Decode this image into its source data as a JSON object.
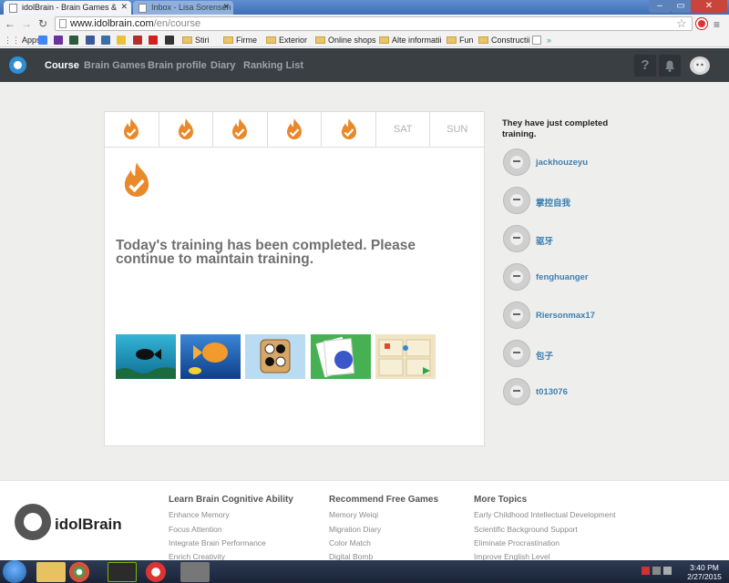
{
  "browser": {
    "tabs": [
      {
        "title": "idolBrain - Brain Games &"
      },
      {
        "title": "Inbox - Lisa Sorensen"
      }
    ],
    "url_host": "www.idolbrain.com",
    "url_path": "/en/course",
    "bookmarks": [
      {
        "label": "Apps",
        "icon": "apps-grid-icon"
      },
      {
        "label": "Stiri",
        "icon": "folder-icon"
      },
      {
        "label": "Firme",
        "icon": "folder-icon"
      },
      {
        "label": "Exterior",
        "icon": "folder-icon"
      },
      {
        "label": "Online shops",
        "icon": "folder-icon"
      },
      {
        "label": "Alte informatii",
        "icon": "folder-icon"
      },
      {
        "label": "Fun",
        "icon": "folder-icon"
      },
      {
        "label": "Constructii",
        "icon": "folder-icon"
      }
    ]
  },
  "site": {
    "nav": [
      {
        "label": "Course",
        "active": true
      },
      {
        "label": "Brain Games",
        "active": false
      },
      {
        "label": "Brain profile",
        "active": false
      },
      {
        "label": "Diary",
        "active": false
      },
      {
        "label": "Ranking List",
        "active": false
      }
    ],
    "help_label": "?"
  },
  "week": [
    {
      "label": "",
      "done": true
    },
    {
      "label": "",
      "done": true
    },
    {
      "label": "",
      "done": true
    },
    {
      "label": "",
      "done": true
    },
    {
      "label": "",
      "done": true
    },
    {
      "label": "SAT",
      "done": false
    },
    {
      "label": "SUN",
      "done": false
    }
  ],
  "completion_message": "Today's training has been completed. Please continue to maintain training.",
  "games": [
    {
      "icon": "fish-game-icon",
      "bg": "#1a8fb0"
    },
    {
      "icon": "goldfish-game-icon",
      "bg": "#1e6cc4"
    },
    {
      "icon": "go-stones-game-icon",
      "bg": "#a8d4ee"
    },
    {
      "icon": "cards-game-icon",
      "bg": "#3fae4f"
    },
    {
      "icon": "puzzle-game-icon",
      "bg": "#efe0be"
    }
  ],
  "sidebar": {
    "title": "They have just completed training.",
    "users": [
      "jackhouzeyu",
      "掌控自我",
      "驱牙",
      "fenghuanger",
      "Riersonmax17",
      "包子",
      "t013076"
    ]
  },
  "footer": {
    "brand": "idolBrain",
    "columns": [
      {
        "heading": "Learn Brain Cognitive Ability",
        "links": [
          "Enhance Memory",
          "Focus Attention",
          "Integrate Brain Performance",
          "Enrich Creativity"
        ]
      },
      {
        "heading": "Recommend Free Games",
        "links": [
          "Memory Weiqi",
          "Migration Diary",
          "Color Match",
          "Digital Bomb"
        ]
      },
      {
        "heading": "More Topics",
        "links": [
          "Early Childhood Intellectual Development",
          "Scientific Background Support",
          "Eliminate Procrastination",
          "Improve English Level"
        ]
      }
    ]
  },
  "taskbar": {
    "time": "3:40 PM",
    "date": "2/27/2015"
  },
  "colors": {
    "flame": "#e8892a",
    "header": "#3a3f44",
    "link": "#3f7fb0"
  }
}
